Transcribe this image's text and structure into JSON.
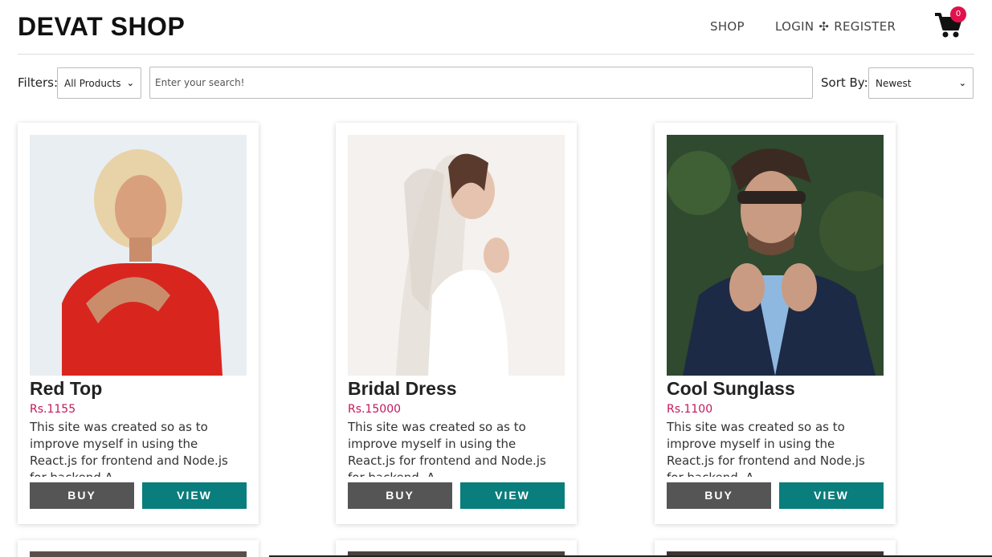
{
  "header": {
    "brand": "DEVAT SHOP",
    "nav_shop": "SHOP",
    "nav_login": "LOGIN",
    "nav_sep": "✣",
    "nav_register": "REGISTER",
    "cart_count": "0"
  },
  "filters": {
    "label": "Filters:",
    "category_selected": "All Products",
    "search_placeholder": "Enter your search!",
    "sort_label": "Sort By:",
    "sort_selected": "Newest"
  },
  "products": [
    {
      "name": "Red Top",
      "price": "Rs.1155",
      "description": "This site was created so as to improve myself in using the React.js for frontend and Node.js for backend.A...",
      "buy_label": "BUY",
      "view_label": "VIEW"
    },
    {
      "name": "Bridal Dress",
      "price": "Rs.15000",
      "description": "This site was created so as to improve myself in using the React.js for frontend and Node.js for backend. A...",
      "buy_label": "BUY",
      "view_label": "VIEW"
    },
    {
      "name": "Cool Sunglass",
      "price": "Rs.1100",
      "description": "This site was created so as to improve myself in using the React.js for frontend and Node.js for backend. A...",
      "buy_label": "BUY",
      "view_label": "VIEW"
    }
  ],
  "colors": {
    "buy_button": "#555555",
    "view_button": "#0a7d7d",
    "price": "#c2185b",
    "badge": "#e0114b"
  }
}
